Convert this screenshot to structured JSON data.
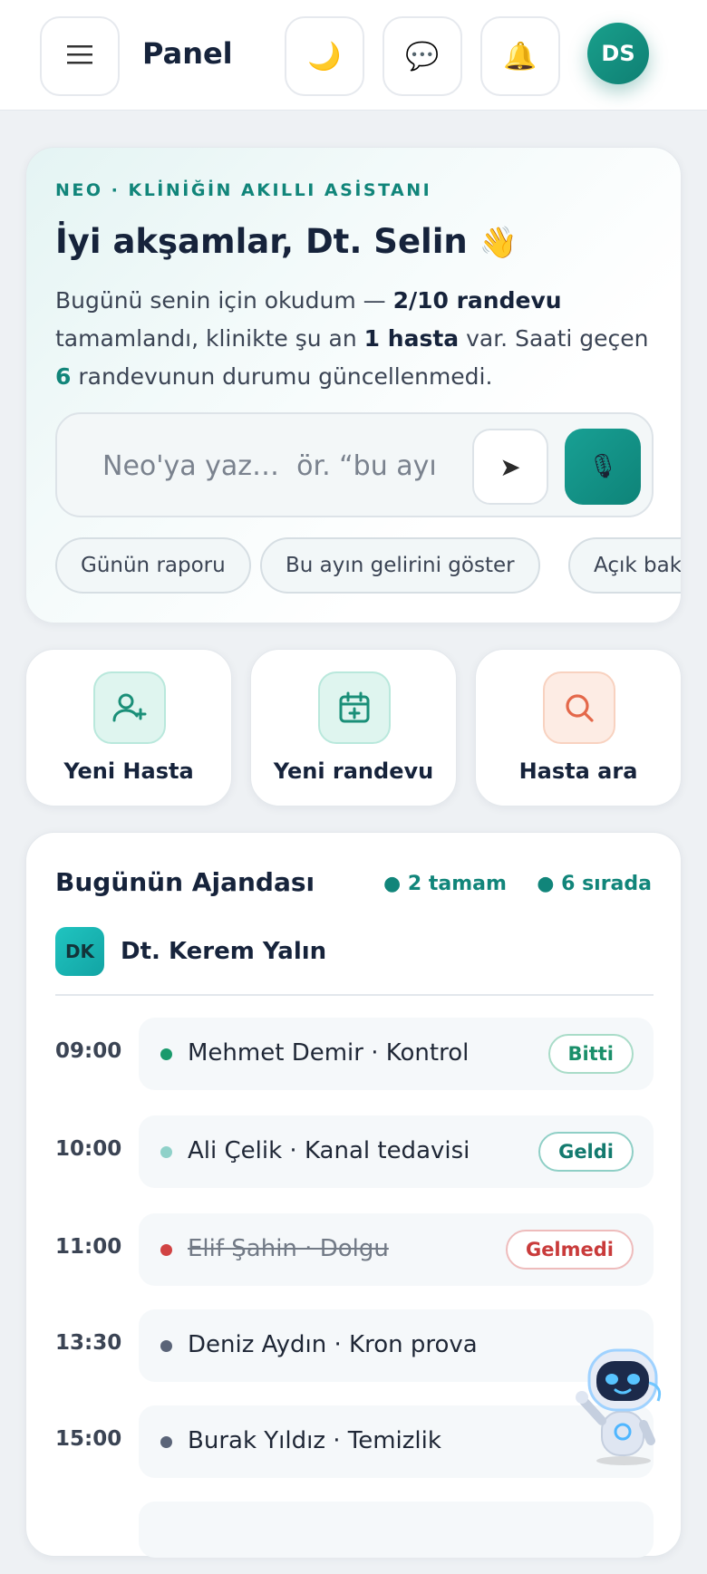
{
  "header": {
    "menu_icon": "hamburger-icon",
    "title": "Panel",
    "icons": [
      "moon-icon",
      "chat-bubble-icon",
      "bell-icon"
    ],
    "avatar_initials": "DS"
  },
  "hero": {
    "eyebrow": "NEO · KLİNİĞİN AKILLI ASİSTANI",
    "greeting": "İyi akşamlar, Dt. Selin",
    "greeting_emoji": "👋",
    "summary": {
      "p1": "Bugünü senin için okudum — ",
      "b1": "2/10 randevu",
      "p2": " tamamlandı, klinikte şu an ",
      "b2": "1 hasta",
      "p3": " var. Saati geçen ",
      "num": "6",
      "p4": " randevunun durumu güncellenmedi."
    },
    "input_placeholder": "Neo'ya yaz…  ör. “bu ayın",
    "chips": [
      "Günün raporu",
      "Bu ayın gelirini göster",
      "Açık bakiyel"
    ]
  },
  "quick_actions": [
    {
      "label": "Yeni Hasta",
      "icon": "user-plus-icon"
    },
    {
      "label": "Yeni randevu",
      "icon": "calendar-plus-icon"
    },
    {
      "label": "Hasta ara",
      "icon": "search-icon"
    }
  ],
  "agenda": {
    "title": "Bugünün Ajandası",
    "stat_done": "● 2 tamam",
    "stat_queue": "● 6 sırada",
    "doctor_initials": "DK",
    "doctor_name": "Dt. Kerem Yalın",
    "slots": [
      {
        "time": "09:00",
        "text": "Mehmet Demir · Kontrol",
        "status": "Bitti"
      },
      {
        "time": "10:00",
        "text": "Ali Çelik · Kanal tedavisi",
        "status": "Geldi"
      },
      {
        "time": "11:00",
        "text": "Elif Şahin · Dolgu",
        "status": "Gelmedi"
      },
      {
        "time": "13:30",
        "text": "Deniz Aydın · Kron prova",
        "status": ""
      },
      {
        "time": "15:00",
        "text": "Burak Yıldız · Temizlik",
        "status": ""
      }
    ]
  },
  "colors": {
    "accent": "#11857a",
    "done": "#1a9a6c",
    "arrived": "#8fd1c9",
    "missed": "#d14343",
    "pending": "#5a6478"
  }
}
